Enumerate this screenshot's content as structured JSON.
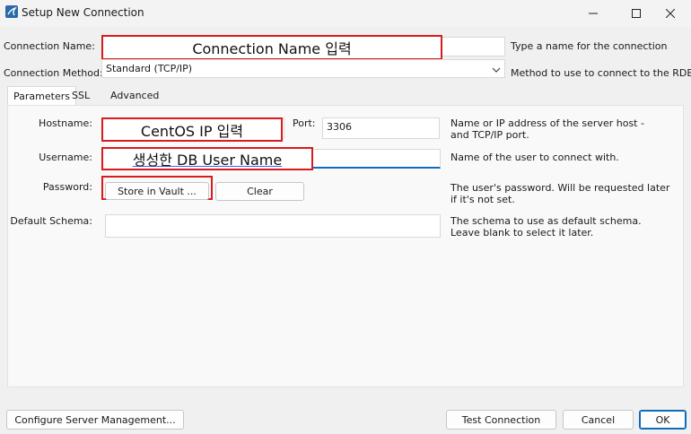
{
  "window": {
    "title": "Setup New Connection",
    "controls": {
      "minimize": "—",
      "maximize": "☐",
      "close": "✕"
    }
  },
  "form": {
    "connection_name_label": "Connection Name:",
    "connection_name_help": "Type a name for the connection",
    "connection_method_label": "Connection Method:",
    "connection_method_value": "Standard (TCP/IP)",
    "connection_method_help": "Method to use to connect to the RDBMS"
  },
  "tabs": [
    "Parameters",
    "SSL",
    "Advanced"
  ],
  "parameters": {
    "hostname_label": "Hostname:",
    "port_label": "Port:",
    "port_value": "3306",
    "hostname_help": "Name or IP address of the server host - and TCP/IP port.",
    "username_label": "Username:",
    "username_help": "Name of the user to connect with.",
    "password_label": "Password:",
    "store_in_vault_label": "Store in Vault ...",
    "clear_label": "Clear",
    "password_help": "The user's password. Will be requested later if it's not set.",
    "default_schema_label": "Default Schema:",
    "default_schema_help": "The schema to use as default schema. Leave blank to select it later."
  },
  "annotations": {
    "connection_name": "Connection Name 입력",
    "hostname": "CentOS IP 입력",
    "username": "생성한 DB User Name"
  },
  "footer": {
    "configure_label": "Configure Server Management...",
    "test_label": "Test Connection",
    "cancel_label": "Cancel",
    "ok_label": "OK"
  },
  "colors": {
    "annotation_border": "#d81b1b",
    "primary_border": "#0f6cbd",
    "app_icon": "#2a6aa8"
  }
}
